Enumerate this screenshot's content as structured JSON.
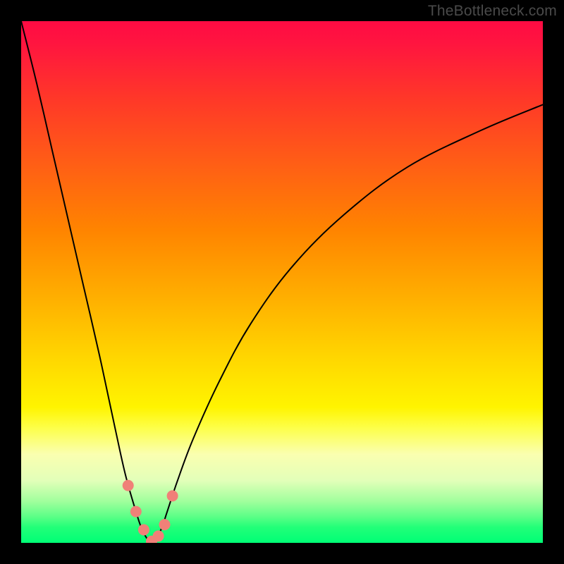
{
  "watermark": "TheBottleneck.com",
  "colors": {
    "frame": "#000000",
    "curve": "#000000",
    "marker": "#f08078",
    "gradient_top": "#ff0b43",
    "gradient_bottom": "#00ff76"
  },
  "chart_data": {
    "type": "line",
    "title": "",
    "xlabel": "",
    "ylabel": "",
    "xlim": [
      0,
      100
    ],
    "ylim": [
      0,
      100
    ],
    "note": "V-shaped bottleneck curve over rainbow gradient; minimum near x≈25; no axes or tick labels shown.",
    "series": [
      {
        "name": "bottleneck-curve",
        "x": [
          0,
          3,
          6,
          9,
          12,
          15,
          18,
          20,
          22,
          23,
          24,
          25,
          26,
          27,
          28,
          30,
          33,
          38,
          44,
          52,
          62,
          74,
          88,
          100
        ],
        "values": [
          100,
          88,
          75,
          62,
          49,
          36,
          22,
          13,
          6,
          3,
          1,
          0,
          1,
          3,
          6,
          12,
          20,
          31,
          42,
          53,
          63,
          72,
          79,
          84
        ]
      }
    ],
    "markers": {
      "name": "threshold-dots",
      "x": [
        20.5,
        22.0,
        23.5,
        25.0,
        26.3,
        27.5,
        29.0
      ],
      "values": [
        11.0,
        6.0,
        2.5,
        0.3,
        1.3,
        3.5,
        9.0
      ]
    }
  }
}
